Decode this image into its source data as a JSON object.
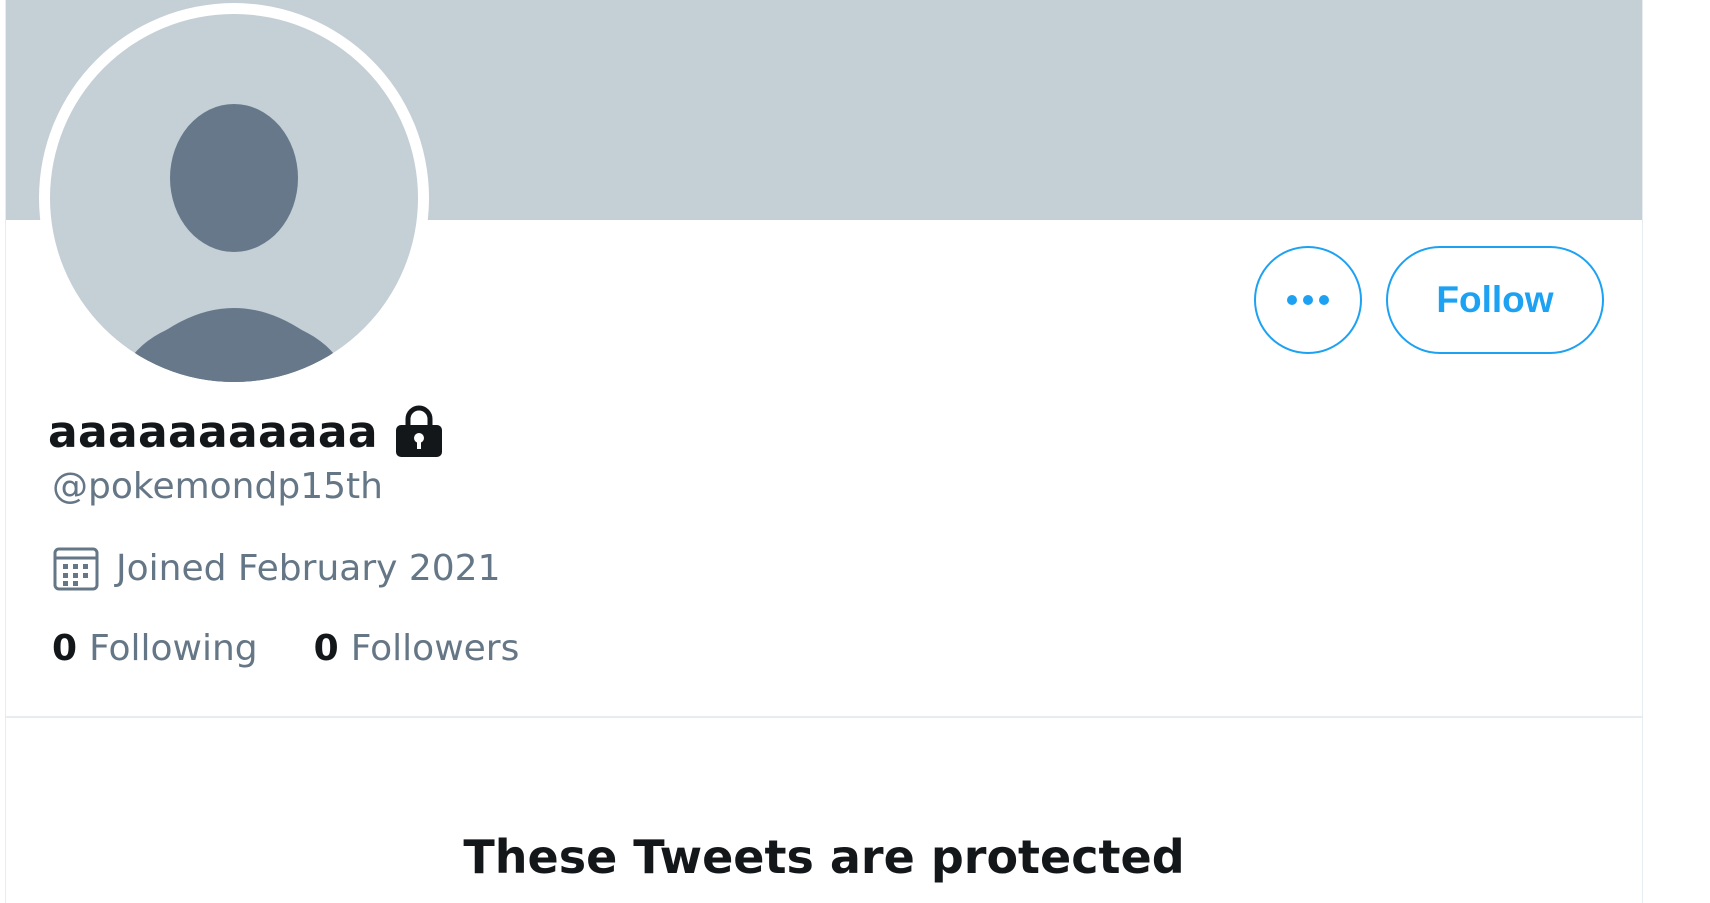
{
  "profile": {
    "display_name": "aaaaaaaaaaa",
    "handle": "@pokemondp15th",
    "joined": "Joined February 2021",
    "following_count": "0",
    "following_label": "Following",
    "followers_count": "0",
    "followers_label": "Followers",
    "protected": true
  },
  "actions": {
    "more_icon": "more-dots-icon",
    "follow_label": "Follow"
  },
  "empty_state": {
    "title": "These Tweets are protected"
  },
  "icons": {
    "lock": "lock-icon",
    "calendar": "calendar-icon",
    "avatar": "default-avatar-icon"
  },
  "colors": {
    "accent": "#1da1f2",
    "banner": "#c4cfd6",
    "secondary_text": "#657786",
    "primary_text": "#14171a",
    "avatar_figure": "#66788a"
  }
}
